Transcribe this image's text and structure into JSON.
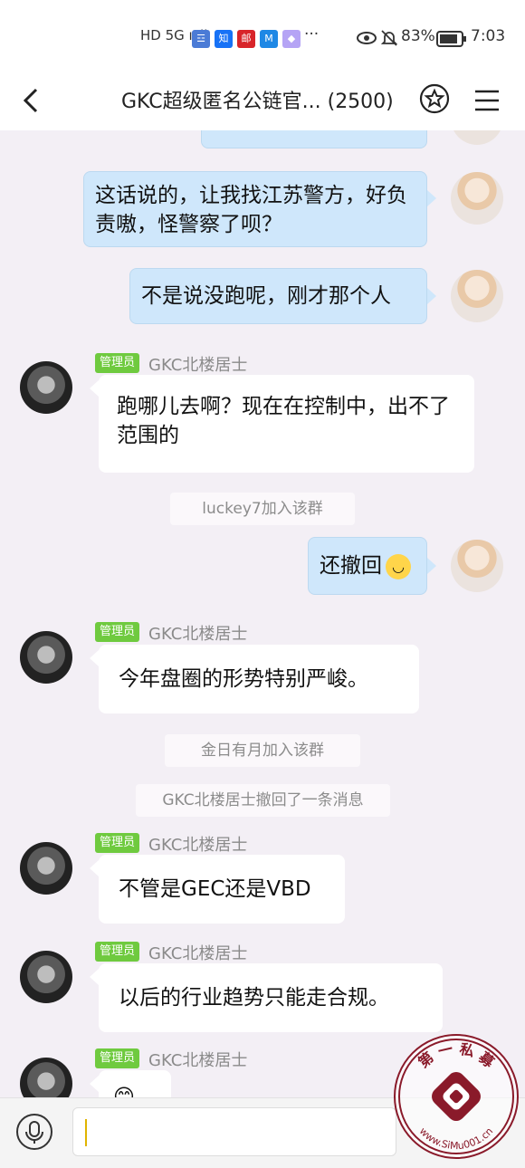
{
  "status_bar": {
    "signal": "HD 5G ıııll",
    "apps": [
      {
        "name": "calendar-app-icon",
        "glyph": "☲",
        "color": "#4b7bd6"
      },
      {
        "name": "zhihu-app-icon",
        "glyph": "知",
        "color": "#1772f6"
      },
      {
        "name": "post-app-icon",
        "glyph": "邮",
        "color": "#d8252a"
      },
      {
        "name": "m-app-icon",
        "glyph": "M",
        "color": "#1e88e5"
      },
      {
        "name": "gem-app-icon",
        "glyph": "◆",
        "color": "#a78bfa"
      }
    ],
    "more": "···",
    "battery": "83%",
    "time": "7:03"
  },
  "nav": {
    "title": "GKC超级匿名公链官... (2500)"
  },
  "messages": {
    "m1": "这话说的，让我找江苏警方，好负责嗷，怪警察了呗？",
    "m2": "不是说没跑呢，刚才那个人",
    "m3_badge": "管理员",
    "m3_sender": "GKC北楼居士",
    "m3": "跑哪儿去啊？现在在控制中，出不了范围的",
    "sys1": "luckey7加入该群",
    "m4": "还撤回",
    "m5_badge": "管理员",
    "m5_sender": "GKC北楼居士",
    "m5": "今年盘圈的形势特别严峻。",
    "sys2": "金日有月加入该群",
    "sys3": "GKC北楼居士撤回了一条消息",
    "m6_badge": "管理员",
    "m6_sender": "GKC北楼居士",
    "m6": "不管是GEC还是VBD",
    "m7_badge": "管理员",
    "m7_sender": "GKC北楼居士",
    "m7": "以后的行业趋势只能走合规。",
    "m8_badge": "管理员",
    "m8_sender": "GKC北楼居士",
    "emoji": "😊"
  },
  "input": {
    "placeholder": ""
  },
  "watermark": {
    "top_text": "第 一 私 募",
    "bottom_text": "www.SiMu001.cn",
    "color": "#8a1a2a"
  }
}
